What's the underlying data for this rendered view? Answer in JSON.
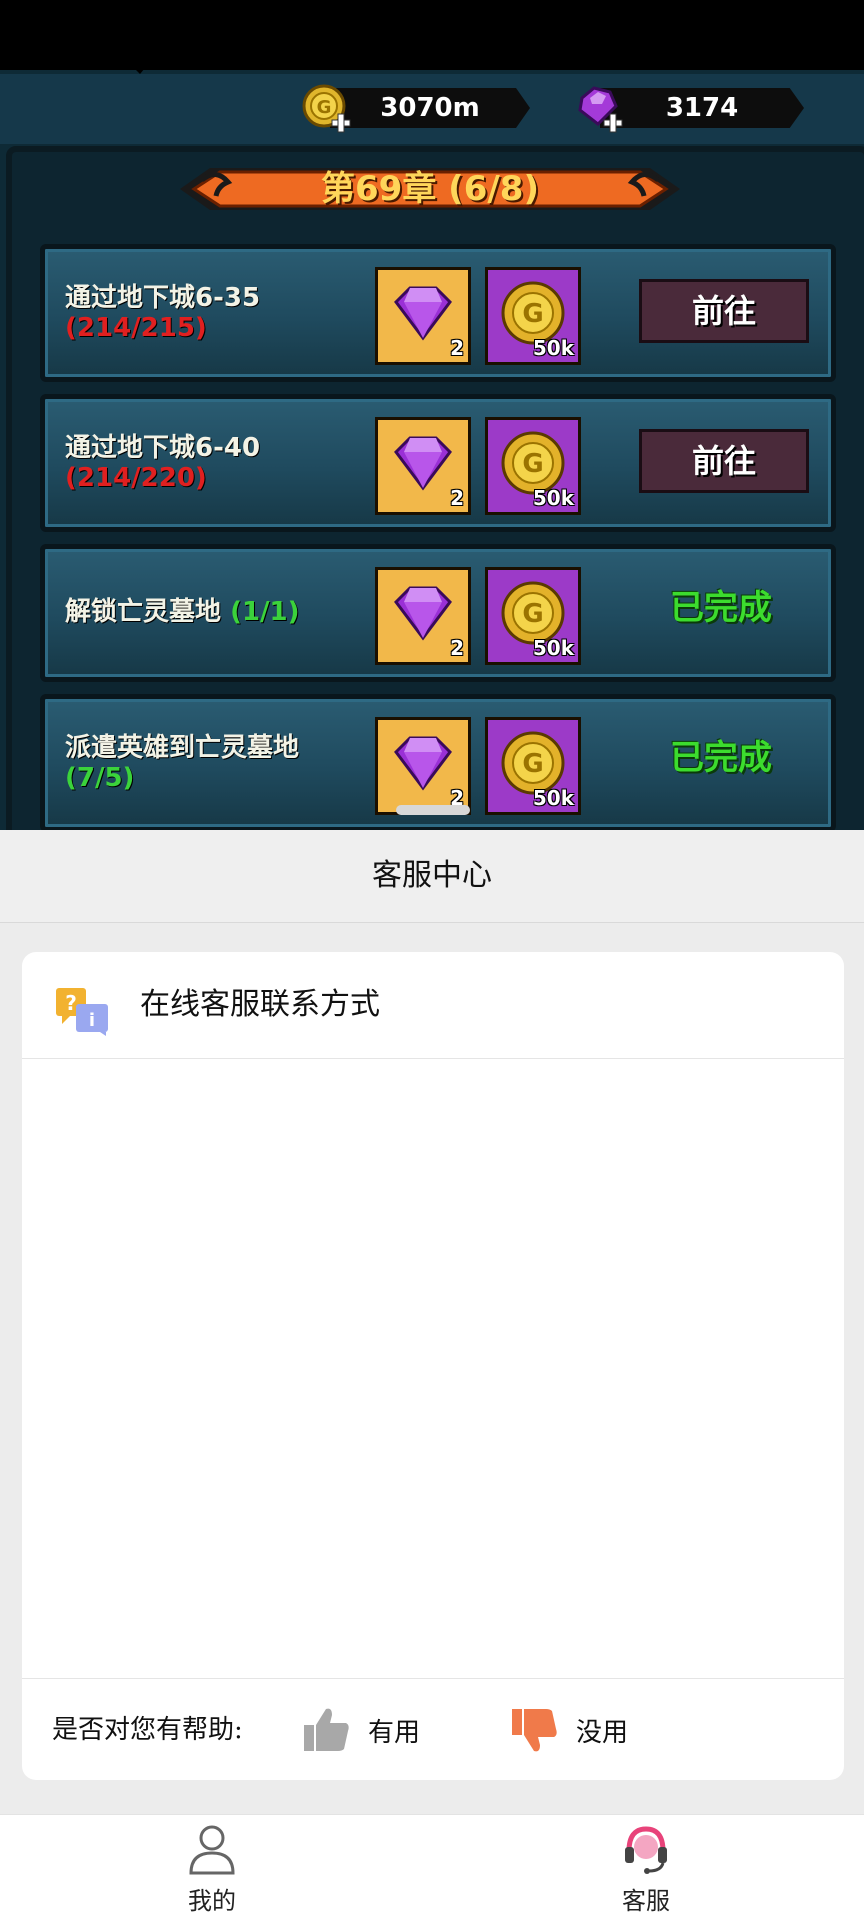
{
  "game": {
    "currency": {
      "gold": "3070m",
      "gems": "3174"
    },
    "chapter_title": "第69章 (6/8)",
    "tasks": [
      {
        "label": "通过地下城6-35",
        "progress": "(214/215)",
        "progress_color": "#e02020",
        "gem_qty": "2",
        "coin_qty": "50k",
        "status": "前往",
        "completed": false
      },
      {
        "label": "通过地下城6-40",
        "progress": "(214/220)",
        "progress_color": "#e02020",
        "gem_qty": "2",
        "coin_qty": "50k",
        "status": "前往",
        "completed": false
      },
      {
        "label": "解锁亡灵墓地",
        "progress": "(1/1)",
        "progress_color": "#3bd33b",
        "gem_qty": "2",
        "coin_qty": "50k",
        "status": "已完成",
        "completed": true
      },
      {
        "label": "派遣英雄到亡灵墓地",
        "progress": "(7/5)",
        "progress_color": "#3bd33b",
        "gem_qty": "2",
        "coin_qty": "50k",
        "status": "已完成",
        "completed": true
      }
    ]
  },
  "service": {
    "header_title": "客服中心",
    "card_title": "在线客服联系方式",
    "helpful_question": "是否对您有帮助:",
    "useful_label": "有用",
    "useless_label": "没用"
  },
  "bottom_nav": {
    "items": [
      {
        "label": "我的",
        "icon": "person-icon"
      },
      {
        "label": "客服",
        "icon": "headset-icon"
      }
    ]
  },
  "colors": {
    "accent_orange": "#f07a4a",
    "completed_green": "#3cdc2e",
    "progress_red": "#e02020"
  }
}
